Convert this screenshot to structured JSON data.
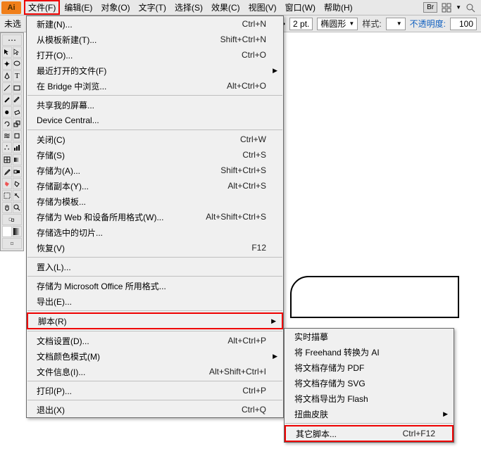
{
  "menubar": {
    "logo": "Ai",
    "items": [
      "文件(F)",
      "编辑(E)",
      "对象(O)",
      "文字(T)",
      "选择(S)",
      "效果(C)",
      "视图(V)",
      "窗口(W)",
      "帮助(H)"
    ],
    "br": "Br"
  },
  "optbar": {
    "truncated": "未选",
    "stroke_value": "2 pt.",
    "stroke_style": "椭圆形",
    "style_label": "样式:",
    "opacity_label": "不透明度:",
    "opacity_value": "100"
  },
  "file_menu": [
    {
      "label": "新建(N)...",
      "shortcut": "Ctrl+N"
    },
    {
      "label": "从模板新建(T)...",
      "shortcut": "Shift+Ctrl+N"
    },
    {
      "label": "打开(O)...",
      "shortcut": "Ctrl+O"
    },
    {
      "label": "最近打开的文件(F)",
      "submenu": true
    },
    {
      "label": "在 Bridge 中浏览...",
      "shortcut": "Alt+Ctrl+O"
    },
    {
      "sep": true
    },
    {
      "label": "共享我的屏幕..."
    },
    {
      "label": "Device Central..."
    },
    {
      "sep": true
    },
    {
      "label": "关闭(C)",
      "shortcut": "Ctrl+W"
    },
    {
      "label": "存储(S)",
      "shortcut": "Ctrl+S"
    },
    {
      "label": "存储为(A)...",
      "shortcut": "Shift+Ctrl+S"
    },
    {
      "label": "存储副本(Y)...",
      "shortcut": "Alt+Ctrl+S"
    },
    {
      "label": "存储为模板..."
    },
    {
      "label": "存储为 Web 和设备所用格式(W)...",
      "shortcut": "Alt+Shift+Ctrl+S"
    },
    {
      "label": "存储选中的切片..."
    },
    {
      "label": "恢复(V)",
      "shortcut": "F12"
    },
    {
      "sep": true
    },
    {
      "label": "置入(L)..."
    },
    {
      "sep": true
    },
    {
      "label": "存储为 Microsoft Office 所用格式..."
    },
    {
      "label": "导出(E)..."
    },
    {
      "sep": true
    },
    {
      "label": "脚本(R)",
      "submenu": true,
      "highlight": true
    },
    {
      "sep": true
    },
    {
      "label": "文档设置(D)...",
      "shortcut": "Alt+Ctrl+P"
    },
    {
      "label": "文档颜色模式(M)",
      "submenu": true
    },
    {
      "label": "文件信息(I)...",
      "shortcut": "Alt+Shift+Ctrl+I"
    },
    {
      "sep": true
    },
    {
      "label": "打印(P)...",
      "shortcut": "Ctrl+P"
    },
    {
      "sep": true
    },
    {
      "label": "退出(X)",
      "shortcut": "Ctrl+Q"
    }
  ],
  "script_submenu": [
    {
      "label": "实时描摹"
    },
    {
      "label": "将 Freehand 转换为 AI"
    },
    {
      "label": "将文档存储为 PDF"
    },
    {
      "label": "将文档存储为 SVG"
    },
    {
      "label": "将文档导出为 Flash"
    },
    {
      "label": "扭曲皮肤",
      "submenu": true
    },
    {
      "sep": true
    },
    {
      "label": "其它脚本...",
      "shortcut": "Ctrl+F12",
      "highlight": true
    }
  ]
}
